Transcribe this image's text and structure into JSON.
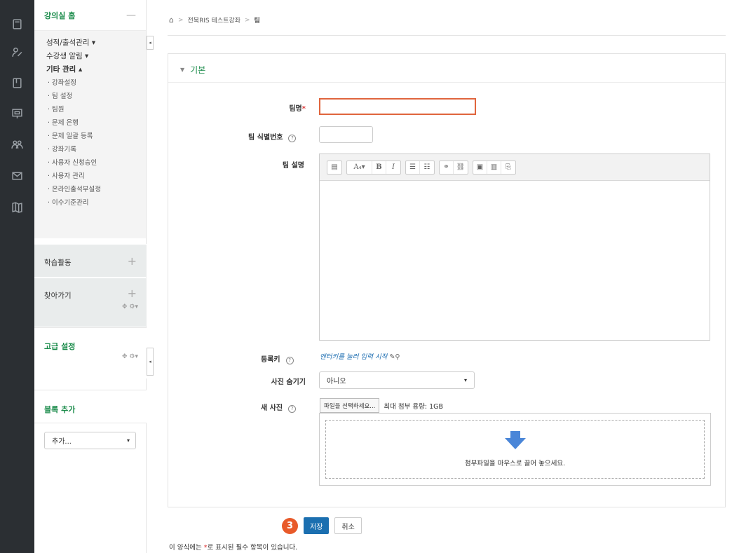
{
  "rail": {
    "icons": [
      "document-icon",
      "users-edit-icon",
      "book-icon",
      "presentation-icon",
      "group-icon",
      "mail-icon",
      "map-icon"
    ]
  },
  "sidebar": {
    "home_label": "강의실 홈",
    "home_toggle": "—",
    "menu": [
      {
        "label": "성적/출석관리 ▾",
        "type": "top"
      },
      {
        "label": "수강생 알림 ▾",
        "type": "top"
      },
      {
        "label": "기타 관리 ▴",
        "type": "bold"
      },
      {
        "label": "· 강좌설정",
        "type": "sub"
      },
      {
        "label": "· 팀 설정",
        "type": "sub"
      },
      {
        "label": "· 팀원",
        "type": "sub"
      },
      {
        "label": "· 문제 은행",
        "type": "sub"
      },
      {
        "label": "· 문제 일괄 등록",
        "type": "sub"
      },
      {
        "label": "· 강좌기록",
        "type": "sub"
      },
      {
        "label": "· 사용자 신청승인",
        "type": "sub"
      },
      {
        "label": "· 사용자 관리",
        "type": "sub"
      },
      {
        "label": "· 온라인출석부설정",
        "type": "sub"
      },
      {
        "label": "· 이수기준관리",
        "type": "sub"
      }
    ],
    "activities_label": "학습활동",
    "goto_label": "찾아가기",
    "advanced_label": "고급 설정",
    "add_block_label": "블록 추가",
    "add_select_value": "추가..."
  },
  "breadcrumb": {
    "home_icon": "home-icon",
    "course": "전북RIS 테스트강좌",
    "current": "팀",
    "sep": ">"
  },
  "form": {
    "section_title": "기본",
    "team_name_label": "팀명",
    "required_mark": "*",
    "team_id_label": "팀 식별번호",
    "team_desc_label": "팀 설명",
    "enrol_key_label": "등록키",
    "enrol_key_link": "엔터키를 눌러 입력 시작",
    "hide_photo_label": "사진 숨기기",
    "hide_photo_value": "아니오",
    "new_photo_label": "새 사진",
    "file_button": "파일을 선택하세요...",
    "max_size": "최대 첨부 용량: 1GB",
    "drop_text": "첨부파일을 마우스로 끌어 놓으세요.",
    "help_glyph": "?"
  },
  "actions": {
    "step_badge": "3",
    "save": "저장",
    "cancel": "취소"
  },
  "footer": {
    "note_prefix": "이 양식에는 ",
    "note_mark": "*",
    "note_suffix": "로 표시된 필수 항목이 있습니다."
  },
  "colors": {
    "accent_green": "#1a8b4a",
    "primary_blue": "#1b6fb0",
    "highlight_orange": "#e85a2a",
    "required_red": "#d33"
  }
}
